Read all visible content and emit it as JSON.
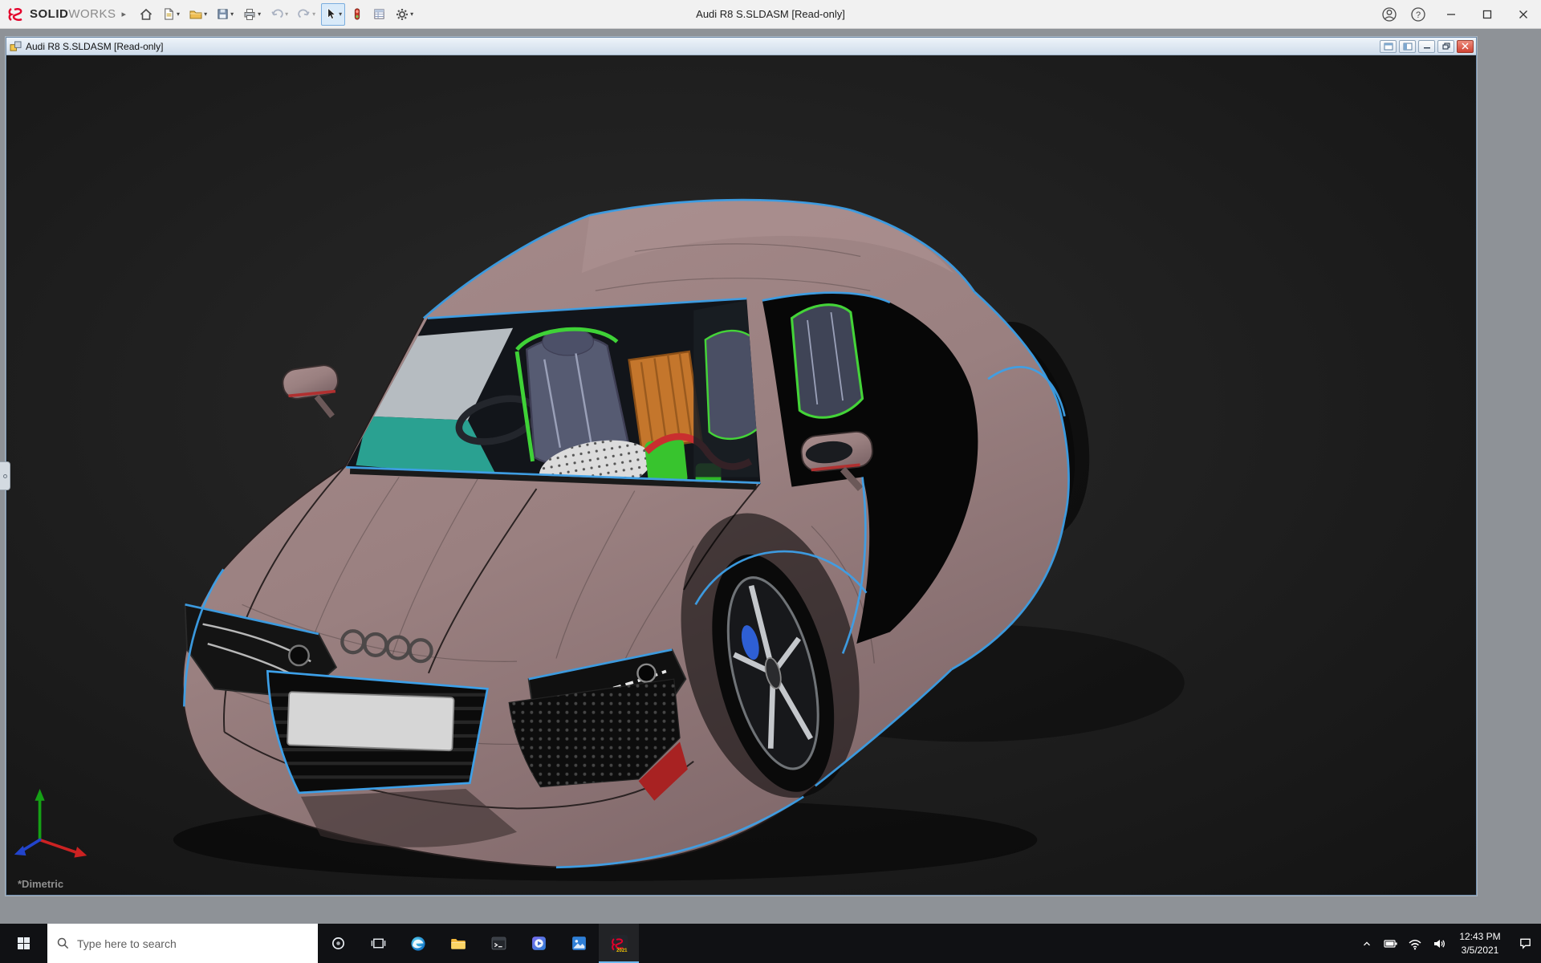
{
  "app": {
    "brand": {
      "bold": "SOLID",
      "light": "WORKS"
    },
    "title": "Audi R8 S.SLDASM [Read-only]",
    "toolbar_icons": [
      "home",
      "new-document",
      "open",
      "save",
      "print",
      "undo",
      "redo",
      "select",
      "rebuild",
      "file-properties",
      "options"
    ],
    "titlebar_right_icons": [
      "account",
      "help",
      "minimize",
      "maximize",
      "close"
    ]
  },
  "document_window": {
    "title": "Audi R8 S.SLDASM [Read-only]",
    "controls": [
      "pane-previous",
      "pane-next",
      "minimize",
      "restore",
      "close"
    ],
    "view_orientation": "*Dimetric"
  },
  "viewport": {
    "model": "Audi R8 sports car assembly, 3/4 front view",
    "body_color": "#9a8080",
    "edge_highlight_color": "#3da0e8",
    "background_color": "#1d1d1d"
  },
  "taskbar": {
    "search_placeholder": "Type here to search",
    "pinned_apps": [
      "cortana",
      "task-view",
      "edge",
      "file-explorer",
      "terminal",
      "media-player",
      "photos",
      "solidworks-2021"
    ],
    "tray_icons": [
      "hidden-icons",
      "battery",
      "network",
      "volume"
    ],
    "clock": {
      "time": "12:43 PM",
      "date": "3/5/2021"
    }
  }
}
